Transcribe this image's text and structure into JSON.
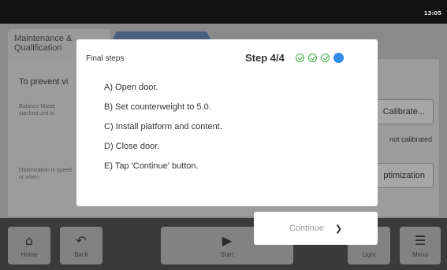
{
  "status_bar": {
    "clock": "13:05"
  },
  "background": {
    "tab_maintenance": "Maintenance & Qualification",
    "hint_title": "To prevent vi",
    "balance_text": "Balance Maste stacked unit to",
    "optimization_text": "Optimization is speed or when",
    "calibrate_button": "Calibrate...",
    "calibration_status": "not calibrated",
    "optimization_button": "ptimization"
  },
  "nav": {
    "home": {
      "label": "Home",
      "icon": "home-icon"
    },
    "back": {
      "label": "Back",
      "icon": "back-arrow-icon"
    },
    "start": {
      "label": "Start",
      "icon": "play-icon"
    },
    "light": {
      "label": "Light",
      "icon": "light-icon"
    },
    "menu": {
      "label": "Menu",
      "icon": "menu-icon"
    }
  },
  "modal": {
    "title": "Final steps",
    "step_label": "Step 4/4",
    "step_indicator": {
      "completed": 3,
      "current": 4,
      "total": 4,
      "completed_color": "#3fae3f",
      "current_color": "#2f8ae8"
    },
    "steps": [
      "A) Open door.",
      "B) Set counterweight to 5.0.",
      "C) Install platform and content.",
      "D) Close door.",
      "E) Tap 'Continue' button."
    ],
    "continue_label": "Continue"
  }
}
